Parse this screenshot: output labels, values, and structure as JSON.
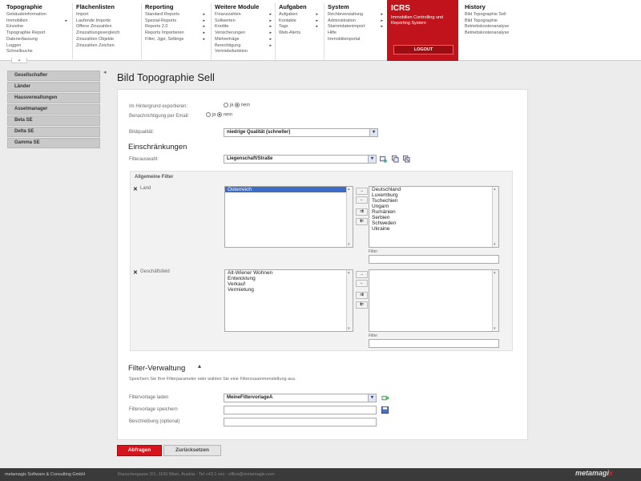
{
  "menu": {
    "topographie": {
      "head": "Topographie",
      "items": [
        "Gebäudeinformation",
        "Immobilien",
        "Einzelne",
        "Topographie Report",
        "Datenerfassung",
        "Loggen",
        "Schnellsuche"
      ]
    },
    "flaechenlisten": {
      "head": "Flächenlisten",
      "items": [
        "Import",
        "Laufende Importe",
        "Offene Zinszahlen",
        "Zinszahlungsvergleich",
        "Zinszahlen Objekte",
        "Zinszahlen Zeichen"
      ]
    },
    "reporting": {
      "head": "Reporting",
      "items": [
        "Standard Reports",
        "Spezial-Reports",
        "Reports 2.0",
        "Reports Importieren",
        "Filter, Jgpr, Settings"
      ]
    },
    "weitere": {
      "head": "Weitere Module",
      "items": [
        "Finanzzahlen",
        "Sollwerten",
        "Kredite",
        "Versicherungen",
        "Mietverträge",
        "Berechtigung",
        "Vertriebsfunktion"
      ]
    },
    "aufgaben": {
      "head": "Aufgaben",
      "items": [
        "Aufgaben",
        "Kontakte",
        "Tags",
        "Web-Alerts"
      ]
    },
    "system": {
      "head": "System",
      "items": [
        "Rechteverwaltung",
        "Administration",
        "Stammdatenimport",
        "Hilfe",
        "Immobilienportal"
      ]
    },
    "history": {
      "head": "History",
      "items": [
        "Bild Topographie Sell",
        "Bild Topographie",
        "Betriebskostenanalyse",
        "Betriebskostenanalyse"
      ]
    }
  },
  "icrs": {
    "title": "ICRS",
    "subtitle": "Immobilien Controlling und Reporting System",
    "logout": "LOGOUT"
  },
  "sidebar": [
    "Gesellschafter",
    "Länder",
    "Hausverwaltungen",
    "Assetmanager",
    "Beta SE",
    "Delta SE",
    "Gamma SE"
  ],
  "page": {
    "title": "Bild Topographie Sell"
  },
  "form": {
    "bg_export_label": "Im Hintergrund exportieren:",
    "email_label": "Benachrichtigung per Email:",
    "ja": "ja",
    "nein": "nein",
    "quality_label": "Bildqualität:",
    "quality_value": "niedrige Qualität (schneller)",
    "restrictions_title": "Einschränkungen",
    "filter_select_label": "Filterauswahl:",
    "filter_select_value": "Liegenschaft/Straße",
    "general_filter_title": "Allgemeine Filter",
    "land_label": "Land",
    "land_selected": [
      "Österreich"
    ],
    "land_available": [
      "Deutschland",
      "Luxemburg",
      "Tschechien",
      "Ungarn",
      "Rumänien",
      "Serbien",
      "Schweden",
      "Ukraine"
    ],
    "filter_caption": "Filter",
    "geschaeft_label": "Geschäftsfeld",
    "geschaeft_selected": [
      "Alt-Wiener Wohnen",
      "Entwicklung",
      "Verkauf",
      "Vermietung"
    ],
    "manage_title": "Filter-Verwaltung",
    "manage_hint": "Speichern Sie Ihre Filterparameter oder wählen Sie eine Filterzusammenstellung aus.",
    "template_load_label": "Filtervorlage laden",
    "template_load_value": "MeineFiltervorlageA",
    "template_save_label": "Filtervorlage speichern",
    "description_label": "Beschreibung (optional)"
  },
  "buttons": {
    "apply": "Abfragen",
    "reset": "Zurücksetzen"
  },
  "footer": {
    "left": "metamagix Software & Consulting GmbH",
    "center": "Rauschergasse 2/1, 1100 Wien, Austria · Tel +43 1 xxx · office@metamagix.com",
    "logo_a": "metamagi",
    "logo_b": "x"
  },
  "colors": {
    "brand_red": "#c0131b",
    "button_red": "#d6141c",
    "selection_blue": "#3e6cc4"
  }
}
